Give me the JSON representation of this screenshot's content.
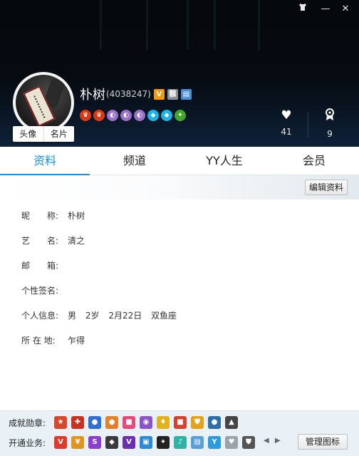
{
  "window": {
    "skin_icon": "shirt-icon",
    "minimize": "—",
    "close": "✕"
  },
  "profile": {
    "name": "朴树",
    "yy_id": "(4038247)",
    "badge_v": "V",
    "badge_vip": "靓",
    "avatar_tabs": [
      "头像",
      "名片"
    ]
  },
  "stats": {
    "likes": "41",
    "awards": "9"
  },
  "tabs": [
    "资料",
    "频道",
    "YY人生",
    "会员"
  ],
  "toolbar": {
    "edit_label": "编辑资料"
  },
  "info": {
    "rows": [
      {
        "label": "昵　　称:",
        "value": "朴树"
      },
      {
        "label": "艺　　名:",
        "value": "清之"
      },
      {
        "label": "邮　　箱:",
        "value": ""
      },
      {
        "label": "个性签名:",
        "value": ""
      },
      {
        "label": "个人信息:",
        "parts": [
          "男",
          "2岁",
          "2月22日",
          "双鱼座"
        ]
      },
      {
        "label": "所 在 地:",
        "value": "乍得"
      }
    ]
  },
  "bottom": {
    "medals_label": "成就勋章:",
    "services_label": "开通业务:",
    "manage_label": "管理图标",
    "prev": "◀",
    "next": "▶"
  },
  "colors": {
    "accent": "#1c8fe0",
    "header_bg": "#05080c"
  }
}
